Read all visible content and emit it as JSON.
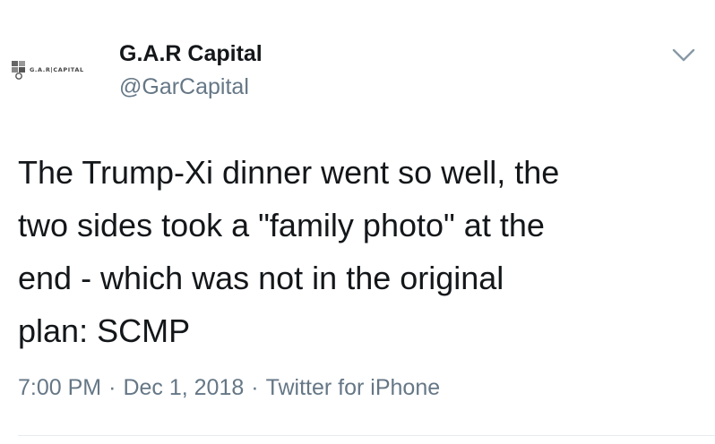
{
  "author": {
    "display_name": "G.A.R Capital",
    "handle": "@GarCapital",
    "avatar_logo_text": "G.A.R|CAPITAL"
  },
  "tweet": {
    "text_lines": [
      "The Trump-Xi dinner went so well, the",
      "two sides took a \"family photo\" at the",
      "end - which was not in the original",
      "plan: SCMP"
    ]
  },
  "meta": {
    "time": "7:00 PM",
    "separator": "·",
    "date": "Dec 1, 2018",
    "source": "Twitter for iPhone"
  },
  "icons": {
    "menu": "chevron-down-icon"
  },
  "colors": {
    "text": "#14171a",
    "secondary": "#657786",
    "divider": "#e6ecf0"
  }
}
